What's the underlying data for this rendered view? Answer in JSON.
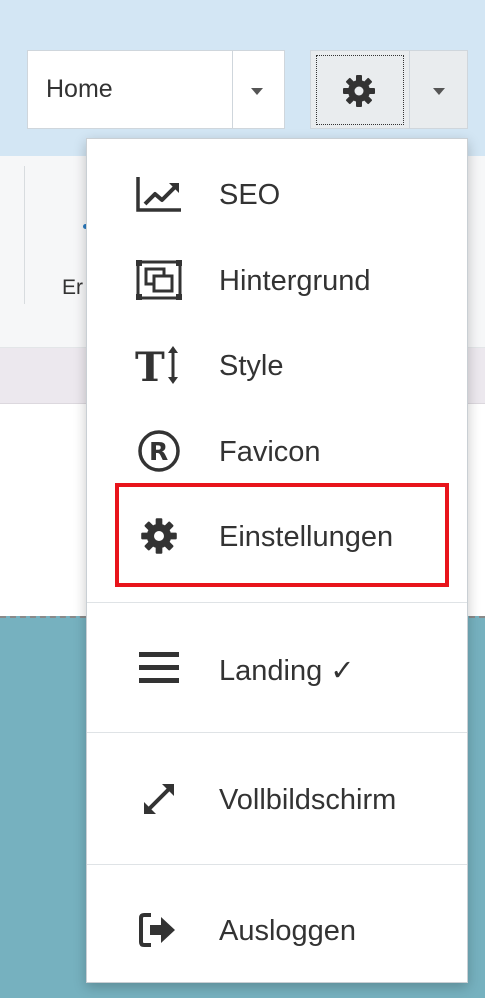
{
  "toolbar": {
    "page_select_value": "Home"
  },
  "ribbon": {
    "partial_label": "Er"
  },
  "settings_menu": {
    "items": [
      {
        "label": "SEO",
        "icon": "chart-line-icon"
      },
      {
        "label": "Hintergrund",
        "icon": "background-frame-icon"
      },
      {
        "label": "Style",
        "icon": "text-height-icon"
      },
      {
        "label": "Favicon",
        "icon": "registered-icon"
      },
      {
        "label": "Einstellungen",
        "icon": "gear-icon"
      },
      {
        "label": "Landing ✓",
        "icon": "bars-icon"
      },
      {
        "label": "Vollbildschirm",
        "icon": "expand-arrows-icon"
      },
      {
        "label": "Ausloggen",
        "icon": "sign-out-icon"
      }
    ]
  },
  "colors": {
    "highlight": "#e8141b",
    "topbar": "#d3e6f4",
    "canvas": "#76b1bf"
  }
}
